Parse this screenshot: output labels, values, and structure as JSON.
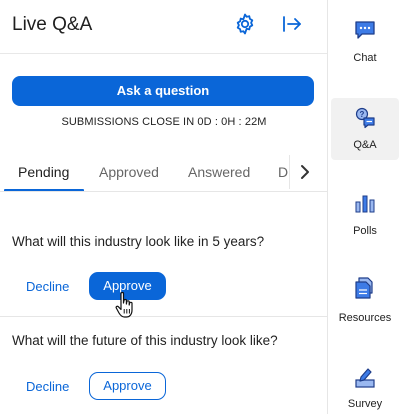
{
  "header": {
    "title": "Live Q&A",
    "settings_icon": "gear-icon",
    "exit_icon": "arrow-right-to-line-icon"
  },
  "ask": {
    "button_label": "Ask a question",
    "close_note": "SUBMISSIONS CLOSE IN 0D : 0H : 22M"
  },
  "tabs": {
    "items": [
      {
        "label": "Pending",
        "active": true
      },
      {
        "label": "Approved",
        "active": false
      },
      {
        "label": "Answered",
        "active": false
      },
      {
        "label": "D",
        "active": false
      }
    ],
    "next_icon": "chevron-right-icon"
  },
  "questions": [
    {
      "text": "What will this industry look like in 5 years?",
      "decline_label": "Decline",
      "approve_label": "Approve",
      "approve_style": "solid"
    },
    {
      "text": "What will the future of this industry look like?",
      "decline_label": "Decline",
      "approve_label": "Approve",
      "approve_style": "outline"
    }
  ],
  "sidebar": {
    "items": [
      {
        "label": "Chat",
        "icon": "chat-icon",
        "active": false
      },
      {
        "label": "Q&A",
        "icon": "qa-icon",
        "active": true
      },
      {
        "label": "Polls",
        "icon": "polls-icon",
        "active": false
      },
      {
        "label": "Resources",
        "icon": "resources-icon",
        "active": false
      },
      {
        "label": "Survey",
        "icon": "survey-icon",
        "active": false
      }
    ]
  },
  "colors": {
    "accent": "#0a66d8",
    "rail_active_bg": "#f1f1f1"
  }
}
